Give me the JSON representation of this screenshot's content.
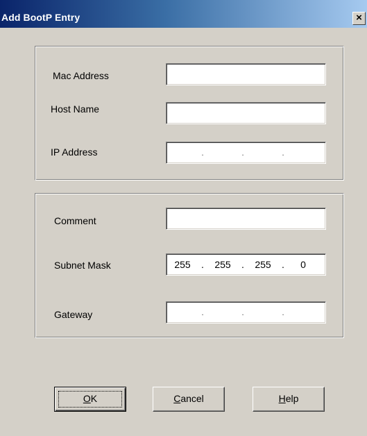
{
  "window": {
    "title": "Add BootP Entry",
    "close_glyph": "×"
  },
  "group1": {
    "mac_label": "Mac Address",
    "mac_value": "",
    "host_label": "Host Name",
    "host_value": "",
    "ip_label": "IP Address",
    "ip_octets": [
      "",
      "",
      "",
      ""
    ]
  },
  "group2": {
    "comment_label": "Comment",
    "comment_value": "",
    "subnet_label": "Subnet Mask",
    "subnet_octets": [
      "255",
      "255",
      "255",
      "0"
    ],
    "gateway_label": "Gateway",
    "gateway_octets": [
      "",
      "",
      "",
      ""
    ]
  },
  "buttons": {
    "ok": {
      "mnemonic": "O",
      "rest": "K"
    },
    "cancel": {
      "mnemonic": "C",
      "rest": "ancel"
    },
    "help": {
      "mnemonic": "H",
      "rest": "elp"
    }
  },
  "ip_separator": "."
}
